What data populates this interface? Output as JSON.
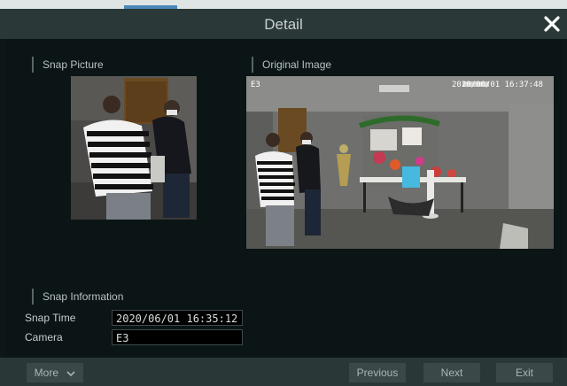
{
  "dialog": {
    "title": "Detail",
    "close_icon": "close-icon"
  },
  "snap_picture": {
    "label": "Snap Picture"
  },
  "original_image": {
    "label": "Original Image",
    "osd_camera": "E3",
    "osd_timestamp": "2020/06/01 16:37:48"
  },
  "snap_information": {
    "label": "Snap Information",
    "snap_time_label": "Snap Time",
    "snap_time_value": "2020/06/01 16:35:12",
    "camera_label": "Camera",
    "camera_value": "E3"
  },
  "footer": {
    "more_label": "More",
    "previous_label": "Previous",
    "next_label": "Next",
    "exit_label": "Exit"
  },
  "colors": {
    "background": "#0d1717",
    "titlebar": "#2b3838",
    "button": "#3b4848",
    "close_icon": "#ffffff"
  }
}
